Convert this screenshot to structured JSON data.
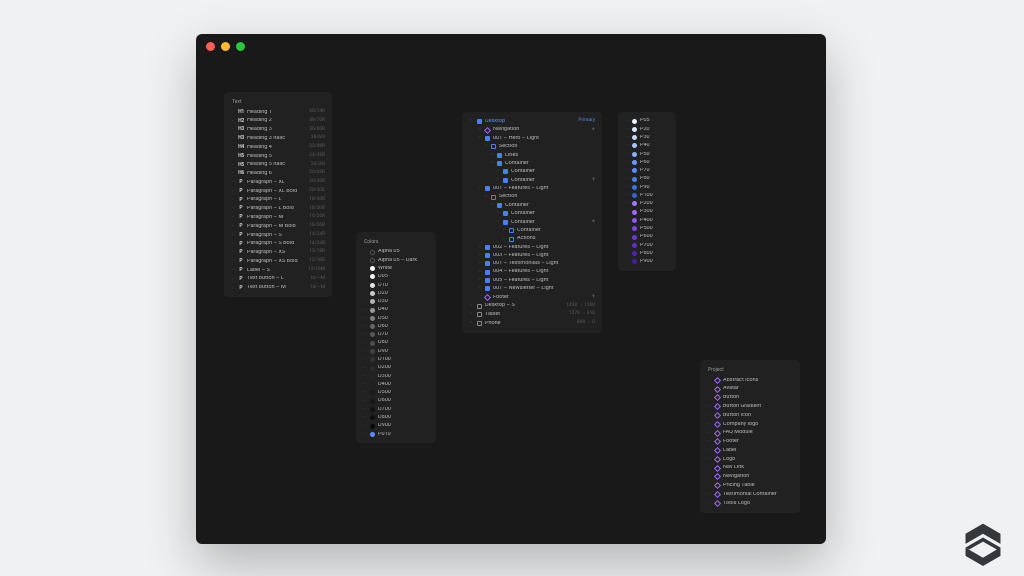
{
  "panels": {
    "text": {
      "title": "Text",
      "items": [
        {
          "icon": "H1",
          "label": "Heading 1",
          "meta": "60/74R"
        },
        {
          "icon": "H2",
          "label": "Heading 2",
          "meta": "48/70R"
        },
        {
          "icon": "H3",
          "label": "Heading 3",
          "meta": "36/60R"
        },
        {
          "icon": "H3",
          "label": "Heading 3 Italic",
          "meta": "36/60I"
        },
        {
          "icon": "H4",
          "label": "Heading 4",
          "meta": "32/48R"
        },
        {
          "icon": "H5",
          "label": "Heading 5",
          "meta": "24/36R"
        },
        {
          "icon": "H5",
          "label": "Heading 5 Italic",
          "meta": "24/36I"
        },
        {
          "icon": "H6",
          "label": "Heading 6",
          "meta": "20/28R"
        },
        {
          "icon": "P",
          "label": "Paragraph – XL",
          "meta": "20/30R"
        },
        {
          "icon": "P",
          "label": "Paragraph – XL Bold",
          "meta": "20/30B"
        },
        {
          "icon": "P",
          "label": "Paragraph – L",
          "meta": "18/30R"
        },
        {
          "icon": "P",
          "label": "Paragraph – L Bold",
          "meta": "18/30B"
        },
        {
          "icon": "P",
          "label": "Paragraph – M",
          "meta": "16/26R"
        },
        {
          "icon": "P",
          "label": "Paragraph – M Bold",
          "meta": "16/26B"
        },
        {
          "icon": "P",
          "label": "Paragraph – S",
          "meta": "14/24R"
        },
        {
          "icon": "P",
          "label": "Paragraph – S Bold",
          "meta": "14/24B"
        },
        {
          "icon": "P",
          "label": "Paragraph – XS",
          "meta": "12/18R"
        },
        {
          "icon": "P",
          "label": "Paragraph – XS Bold",
          "meta": "12/18B"
        },
        {
          "icon": "P",
          "label": "Label – S",
          "meta": "12/16M"
        },
        {
          "icon": "P",
          "label": "Text button – L",
          "meta": "16/—M"
        },
        {
          "icon": "P",
          "label": "Text button – M",
          "meta": "14/—M"
        }
      ]
    },
    "colors": {
      "title": "Colors",
      "items": [
        {
          "hex": null,
          "label": "Alpha 05"
        },
        {
          "hex": null,
          "label": "Alpha 05 – Dark"
        },
        {
          "hex": "#ffffff",
          "label": "White"
        },
        {
          "hex": "#f2f2f2",
          "label": "D05"
        },
        {
          "hex": "#e6e6e6",
          "label": "D10"
        },
        {
          "hex": "#cccccc",
          "label": "D20"
        },
        {
          "hex": "#b3b3b3",
          "label": "D30"
        },
        {
          "hex": "#999999",
          "label": "D40"
        },
        {
          "hex": "#808080",
          "label": "D50"
        },
        {
          "hex": "#666666",
          "label": "D60"
        },
        {
          "hex": "#595959",
          "label": "D70"
        },
        {
          "hex": "#4d4d4d",
          "label": "D80"
        },
        {
          "hex": "#404040",
          "label": "D90"
        },
        {
          "hex": "#333333",
          "label": "D100"
        },
        {
          "hex": "#2b2b2b",
          "label": "D200"
        },
        {
          "hex": "#242424",
          "label": "D300"
        },
        {
          "hex": "#1f1f1f",
          "label": "D400"
        },
        {
          "hex": "#1a1a1a",
          "label": "D500"
        },
        {
          "hex": "#161616",
          "label": "D600"
        },
        {
          "hex": "#121212",
          "label": "D700"
        },
        {
          "hex": "#0e0e0e",
          "label": "D800"
        },
        {
          "hex": "#0a0a0a",
          "label": "D900"
        },
        {
          "hex": "#5b8dff",
          "label": "P010"
        }
      ]
    },
    "primary": {
      "items": [
        {
          "hex": "#eef3ff",
          "label": "P05"
        },
        {
          "hex": "#dbe6ff",
          "label": "P20"
        },
        {
          "hex": "#c7d9ff",
          "label": "P30"
        },
        {
          "hex": "#a9c4ff",
          "label": "P40"
        },
        {
          "hex": "#8cafff",
          "label": "P50"
        },
        {
          "hex": "#6e99ff",
          "label": "P60"
        },
        {
          "hex": "#5b8dff",
          "label": "P70"
        },
        {
          "hex": "#4a7dff",
          "label": "P80"
        },
        {
          "hex": "#3e6ff0",
          "label": "P90"
        },
        {
          "hex": "#3461df",
          "label": "P100"
        },
        {
          "hex": "#9a7dff",
          "label": "P200"
        },
        {
          "hex": "#a066ff",
          "label": "P300"
        },
        {
          "hex": "#8f55f2",
          "label": "P400"
        },
        {
          "hex": "#7e46e3",
          "label": "P500"
        },
        {
          "hex": "#6e39d3",
          "label": "P600"
        },
        {
          "hex": "#5f2ec3",
          "label": "P700"
        },
        {
          "hex": "#5126b1",
          "label": "P800"
        },
        {
          "hex": "#431f9c",
          "label": "P900"
        }
      ]
    },
    "layers": {
      "root": {
        "label": "Desktop",
        "tag": "Primary"
      },
      "tree": [
        {
          "d": 1,
          "k": "dia",
          "label": "Navigation",
          "plus": true
        },
        {
          "d": 1,
          "k": "blue",
          "label": "001 – Hero – Light"
        },
        {
          "d": 2,
          "k": "blueO",
          "label": "Section"
        },
        {
          "d": 3,
          "k": "blue",
          "label": "Lines"
        },
        {
          "d": 3,
          "k": "blue",
          "label": "Container"
        },
        {
          "d": 4,
          "k": "blue",
          "label": "Container"
        },
        {
          "d": 4,
          "k": "blue",
          "label": "Container",
          "plus": true
        },
        {
          "d": 1,
          "k": "blue",
          "label": "001 – Features – Light"
        },
        {
          "d": 2,
          "k": "blueO",
          "label": "Section"
        },
        {
          "d": 3,
          "k": "blue",
          "label": "Container"
        },
        {
          "d": 4,
          "k": "blue",
          "label": "Container"
        },
        {
          "d": 4,
          "k": "blue",
          "label": "Container",
          "plus": true
        },
        {
          "d": 5,
          "k": "blueO",
          "label": "Container"
        },
        {
          "d": 5,
          "k": "blueO",
          "label": "Actions"
        },
        {
          "d": 1,
          "k": "blue",
          "label": "002 – Features – Light"
        },
        {
          "d": 1,
          "k": "blue",
          "label": "003 – Features – Light"
        },
        {
          "d": 1,
          "k": "blue",
          "label": "001 – Testimonials – Light"
        },
        {
          "d": 1,
          "k": "blue",
          "label": "004 – Features – Light"
        },
        {
          "d": 1,
          "k": "blue",
          "label": "005 – Features – Light"
        },
        {
          "d": 1,
          "k": "blue",
          "label": "001 – Newsletter – Light"
        },
        {
          "d": 1,
          "k": "dia",
          "label": "Footer",
          "plus": true
        }
      ],
      "breakpoints": [
        {
          "label": "Desktop – S",
          "meta": "1438 → 1200"
        },
        {
          "label": "Tablet",
          "meta": "1279 → 810"
        },
        {
          "label": "Phone",
          "meta": "809 → 0"
        }
      ]
    },
    "project": {
      "title": "Project",
      "items": [
        {
          "label": "Abstract Icons"
        },
        {
          "label": "Avatar"
        },
        {
          "label": "Button"
        },
        {
          "label": "Button Gradient"
        },
        {
          "label": "Button Icon"
        },
        {
          "label": "Company logo"
        },
        {
          "label": "FAQ Module"
        },
        {
          "label": "Footer"
        },
        {
          "label": "Label"
        },
        {
          "label": "Logo"
        },
        {
          "label": "Nav Link"
        },
        {
          "label": "Navigation"
        },
        {
          "label": "Pricing Table"
        },
        {
          "label": "Testimonial Container"
        },
        {
          "label": "Tools Logo"
        }
      ]
    }
  }
}
